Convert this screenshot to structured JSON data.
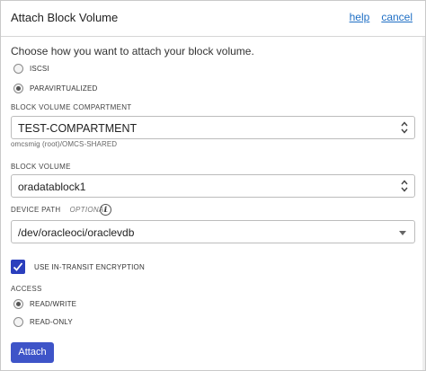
{
  "dialog": {
    "title": "Attach Block Volume",
    "help_label": "help",
    "cancel_label": "cancel"
  },
  "attach_type": {
    "prompt": "Choose how you want to attach your block volume.",
    "options": [
      {
        "label": "ISCSI",
        "selected": false
      },
      {
        "label": "PARAVIRTUALIZED",
        "selected": true
      }
    ]
  },
  "compartment": {
    "label": "BLOCK VOLUME COMPARTMENT",
    "value": "TEST-COMPARTMENT",
    "helper": "omcsmig (root)/OMCS-SHARED"
  },
  "block_volume": {
    "label": "BLOCK VOLUME",
    "value": "oradatablock1"
  },
  "device_path": {
    "label": "DEVICE PATH",
    "optional": "OPTIONAL",
    "info_icon": "i",
    "value": "/dev/oracleoci/oraclevdb"
  },
  "encryption": {
    "label": "USE IN-TRANSIT ENCRYPTION",
    "checked": true
  },
  "access": {
    "label": "ACCESS",
    "options": [
      {
        "label": "READ/WRITE",
        "selected": true
      },
      {
        "label": "READ-ONLY",
        "selected": false
      }
    ]
  },
  "attach_button_label": "Attach",
  "colors": {
    "link": "#1f6fc5",
    "primary_button": "#3e54c8",
    "checkbox": "#2b3fbd"
  }
}
